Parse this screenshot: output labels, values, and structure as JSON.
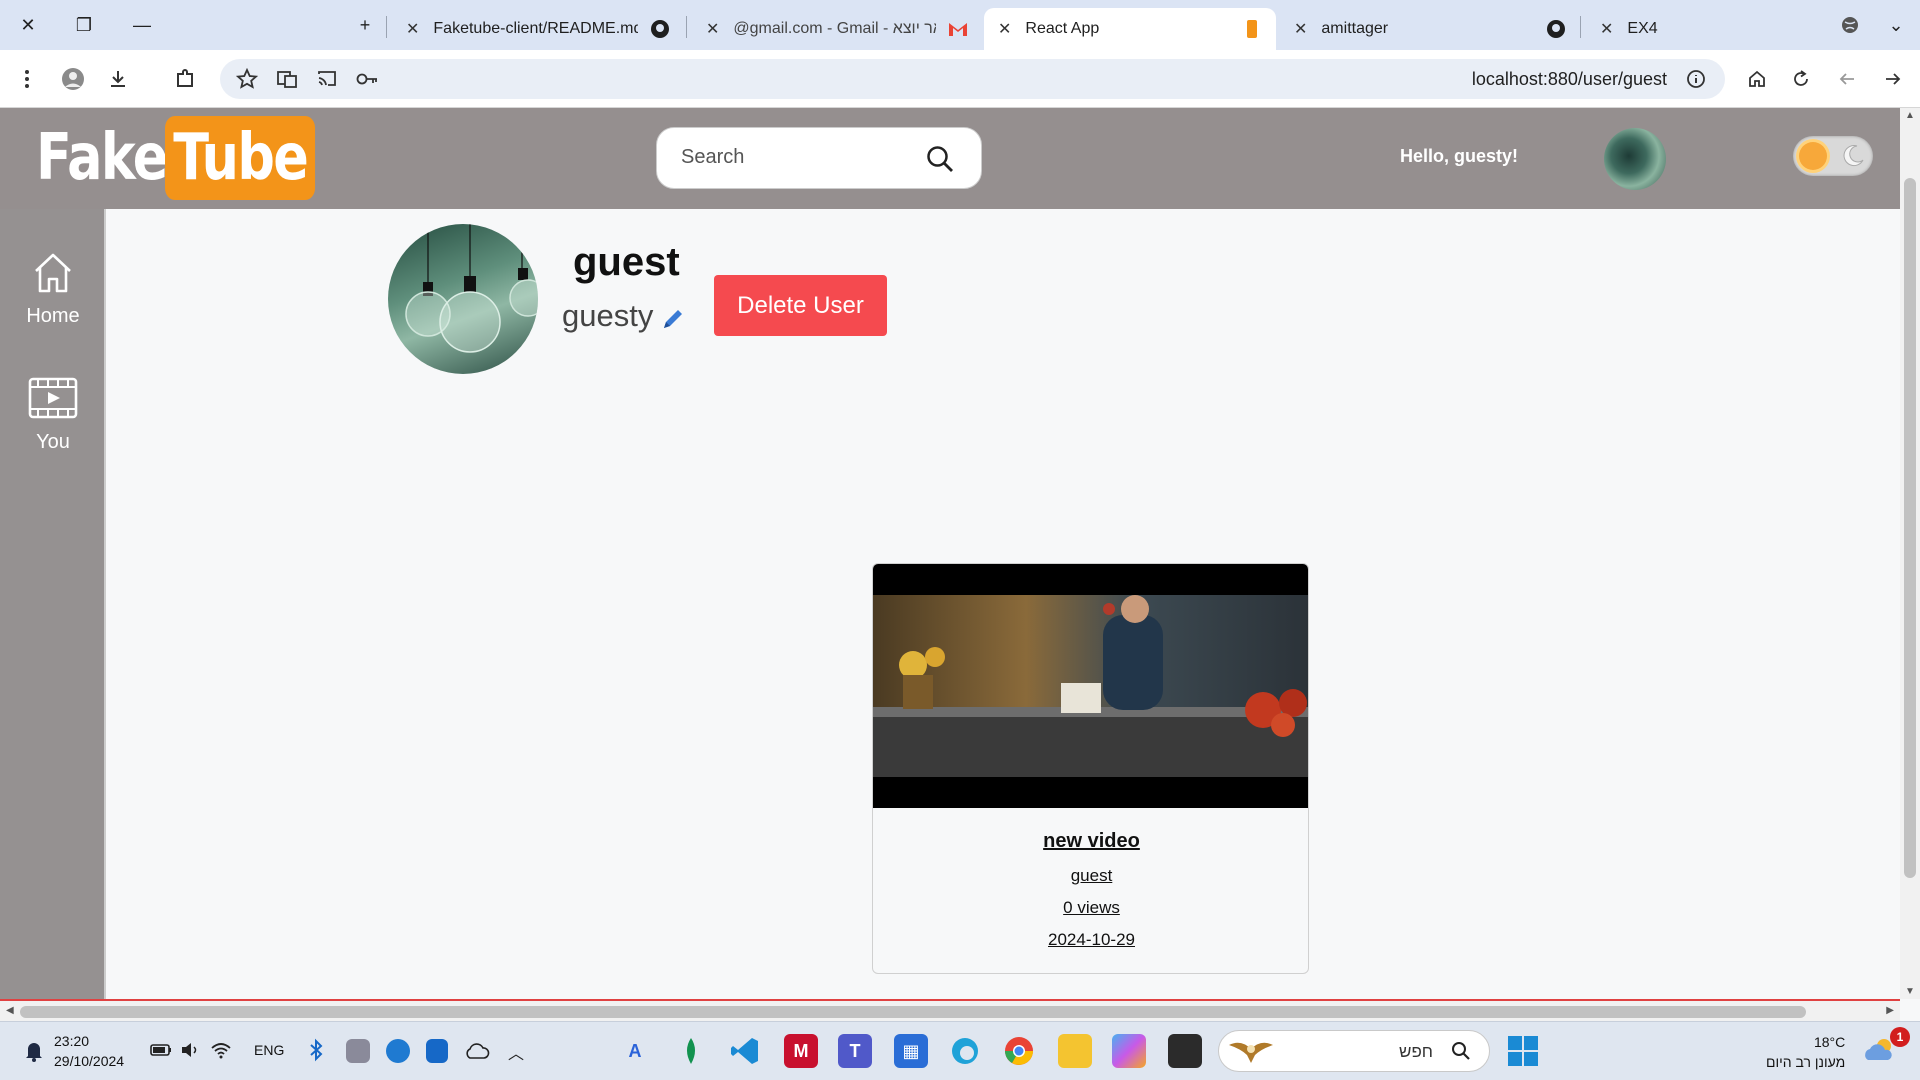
{
  "browser": {
    "tabs": [
      {
        "label": "Faketube-client/README.md at",
        "favicon": "github-icon"
      },
      {
        "label": "@gmail.com - Gmail - דואר יוצא",
        "favicon": "gmail-icon"
      },
      {
        "label": "React App",
        "favicon": "react-app-icon",
        "active": true
      },
      {
        "label": "amittager",
        "favicon": "github-icon"
      },
      {
        "label": "EX4",
        "favicon": "github-icon"
      }
    ],
    "url": "localhost:880/user/guest"
  },
  "header": {
    "logo_fake": "Fake",
    "logo_tube": "Tube",
    "search_placeholder": "Search",
    "greeting": "Hello, guesty!"
  },
  "sidebar": {
    "items": [
      {
        "label": "Home",
        "icon": "home-icon"
      },
      {
        "label": "You",
        "icon": "video-library-icon"
      }
    ]
  },
  "profile": {
    "username": "guest",
    "display_name": "guesty",
    "delete_label": "Delete User"
  },
  "videos": [
    {
      "title": "new video",
      "author": "guest",
      "views": "0 views",
      "date": "2024-10-29"
    }
  ],
  "taskbar": {
    "time": "23:20",
    "date": "29/10/2024",
    "language": "ENG",
    "search_text": "חפש",
    "temperature": "18°C",
    "weather_text": "מעונן רב היום",
    "notification_count": "1"
  },
  "colors": {
    "header_bg": "#958f8f",
    "logo_accent": "#f39419",
    "delete_button": "#f54a4f",
    "active_tab": "#ffffff",
    "tab_strip": "#dbe4f4"
  }
}
